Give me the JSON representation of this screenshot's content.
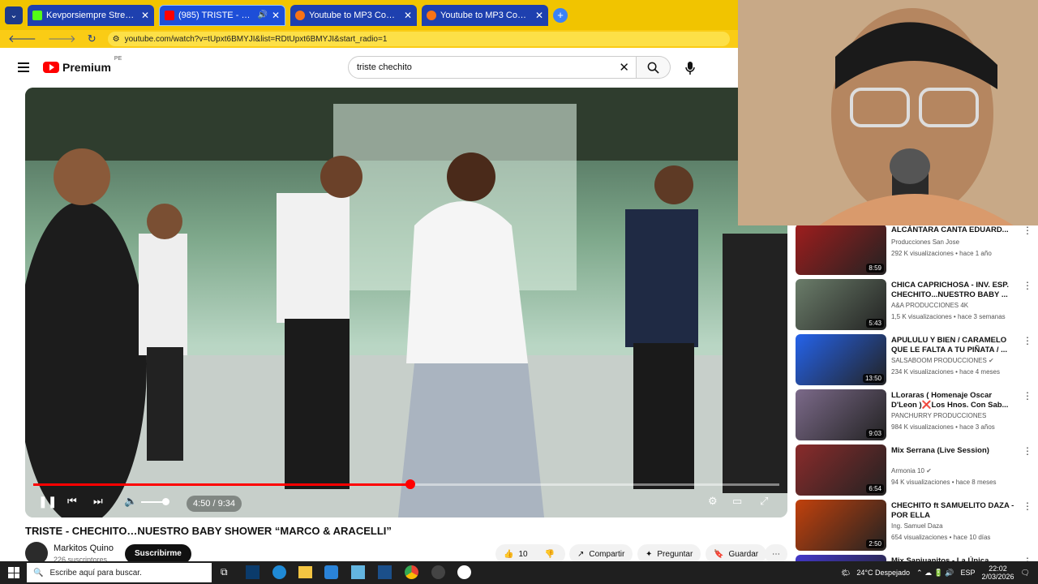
{
  "browser": {
    "tabs": [
      {
        "title": "Kevporsiempre Stream - Watch",
        "favicon_color": "#53fc18"
      },
      {
        "title": "(985) TRISTE - CHECHITO...",
        "favicon_color": "#ff0000"
      },
      {
        "title": "Youtube to MP3 Converter",
        "favicon_color": "#f97316"
      },
      {
        "title": "Youtube to MP3 Converter",
        "favicon_color": "#f97316"
      }
    ],
    "url": "youtube.com/watch?v=tUpxt6BMYJI&list=RDtUpxt6BMYJI&start_radio=1"
  },
  "youtube": {
    "logo_text": "Premium",
    "logo_region": "PE",
    "search_value": "triste chechito"
  },
  "player": {
    "time": "4:50 / 9:34",
    "progress": 0.505,
    "volume": 0.85
  },
  "video": {
    "title": "TRISTE - CHECHITO…NUESTRO BABY SHOWER “MARCO & ARACELLI”",
    "channel": "Markitos Quino",
    "subscribers": "226 suscriptores",
    "subscribe_label": "Suscribirme",
    "likes": "10",
    "share_label": "Compartir",
    "ask_label": "Preguntar",
    "save_label": "Guardar"
  },
  "related": [
    {
      "title": "ALCÁNTARA CANTA EDUARD...",
      "channel": "Producciones San Jose",
      "meta": "292 K visualizaciones • hace 1 año",
      "duration": "8:59",
      "thumb_color": "#9f1d1d",
      "verified": false
    },
    {
      "title": "CHICA CAPRICHOSA - INV. ESP. CHECHITO...NUESTRO BABY ...",
      "channel": "A&A PRODUCCIONES 4K",
      "meta": "1,5 K visualizaciones • hace 3 semanas",
      "duration": "5:43",
      "thumb_color": "#6b7d6a",
      "verified": false
    },
    {
      "title": "APULULU Y BIEN / CARAMELO QUE LE FALTA A TU PIÑATA / ...",
      "channel": "SALSABOOM PRODUCCIONES",
      "meta": "234 K visualizaciones • hace 4 meses",
      "duration": "13:50",
      "thumb_color": "#2563eb",
      "verified": true
    },
    {
      "title": "LLoraras ( Homenaje Oscar D'Leon )❌Los Hnos. Con Sab...",
      "channel": "PANCHURRY PRODUCCIONES",
      "meta": "984 K visualizaciones • hace 3 años",
      "duration": "9:03",
      "thumb_color": "#7c6a8a",
      "verified": false
    },
    {
      "title": "Mix Serrana (Live Session)",
      "channel": "Armonia 10",
      "meta": "94 K visualizaciones • hace 8 meses",
      "duration": "6:54",
      "thumb_color": "#8a2b2b",
      "verified": true
    },
    {
      "title": "CHECHITO ft SAMUELITO DAZA - POR ELLA",
      "channel": "Ing. Samuel Daza",
      "meta": "654 visualizaciones • hace 10 días",
      "duration": "2:50",
      "thumb_color": "#c2410c",
      "verified": false
    },
    {
      "title": "Mix Sanjuanitos - La Única",
      "channel": "",
      "meta": "",
      "duration": "",
      "thumb_color": "#4338ca",
      "verified": false
    }
  ],
  "taskbar": {
    "search_placeholder": "Escribe aquí para buscar.",
    "weather": "24°C  Despejado",
    "lang": "ESP",
    "time": "22:02",
    "date": "2/03/2026"
  }
}
